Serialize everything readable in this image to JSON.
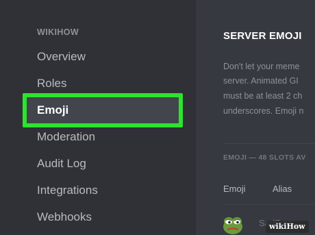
{
  "sidebar": {
    "server_name": "WIKIHOW",
    "items": [
      {
        "label": "Overview"
      },
      {
        "label": "Roles"
      },
      {
        "label": "Emoji",
        "selected": true
      },
      {
        "label": "Moderation"
      },
      {
        "label": "Audit Log"
      },
      {
        "label": "Integrations"
      },
      {
        "label": "Webhooks"
      }
    ],
    "highlight_color": "#2ee32e"
  },
  "main": {
    "title": "SERVER EMOJI",
    "description_lines": [
      "Don't let your meme",
      "server. Animated GI",
      "must be at least 2 ch",
      "underscores. Emoji n"
    ],
    "section_label": "EMOJI — 48 SLOTS AV",
    "columns": [
      "Emoji",
      "Alias"
    ],
    "emoji_row": {
      "icon": "pepe-frog-icon",
      "alias": "SadFrog"
    }
  },
  "watermark": {
    "text": "wikiHow"
  }
}
